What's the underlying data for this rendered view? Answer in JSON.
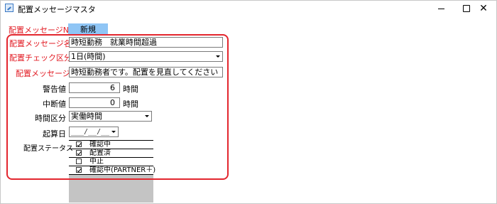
{
  "window": {
    "title": "配置メッセージマスタ",
    "minimize_glyph": "—",
    "maximize_glyph": "☐",
    "close_glyph": "✕"
  },
  "form": {
    "message_no_label": "配置メッセージNO",
    "message_no_value": "新規",
    "message_name_label": "配置メッセージ名",
    "message_name_value": "時短勤務　就業時間超過",
    "check_type_label": "配置チェック区分",
    "check_type_value": "1日(時間)",
    "message_label": "配置メッセージ",
    "message_value": "時短勤務者です。配置を見直してください",
    "warning_label": "警告値",
    "warning_value": "6",
    "warning_unit": "時間",
    "interrupt_label": "中断値",
    "interrupt_value": "0",
    "interrupt_unit": "時間",
    "time_type_label": "時間区分",
    "time_type_value": "実働時間",
    "start_date_label": "起算日",
    "start_date_value": "___/__/__",
    "status_label": "配置ステータス",
    "status_items": [
      {
        "label": "確認中",
        "checked": true
      },
      {
        "label": "配置済",
        "checked": true
      },
      {
        "label": "中止",
        "checked": false
      },
      {
        "label": "確認中(PARTNER＋)",
        "checked": true
      }
    ]
  },
  "colors": {
    "required_label": "#e21b23",
    "highlight_border": "#e3262e",
    "new_badge_bg": "#8fc5f5"
  }
}
